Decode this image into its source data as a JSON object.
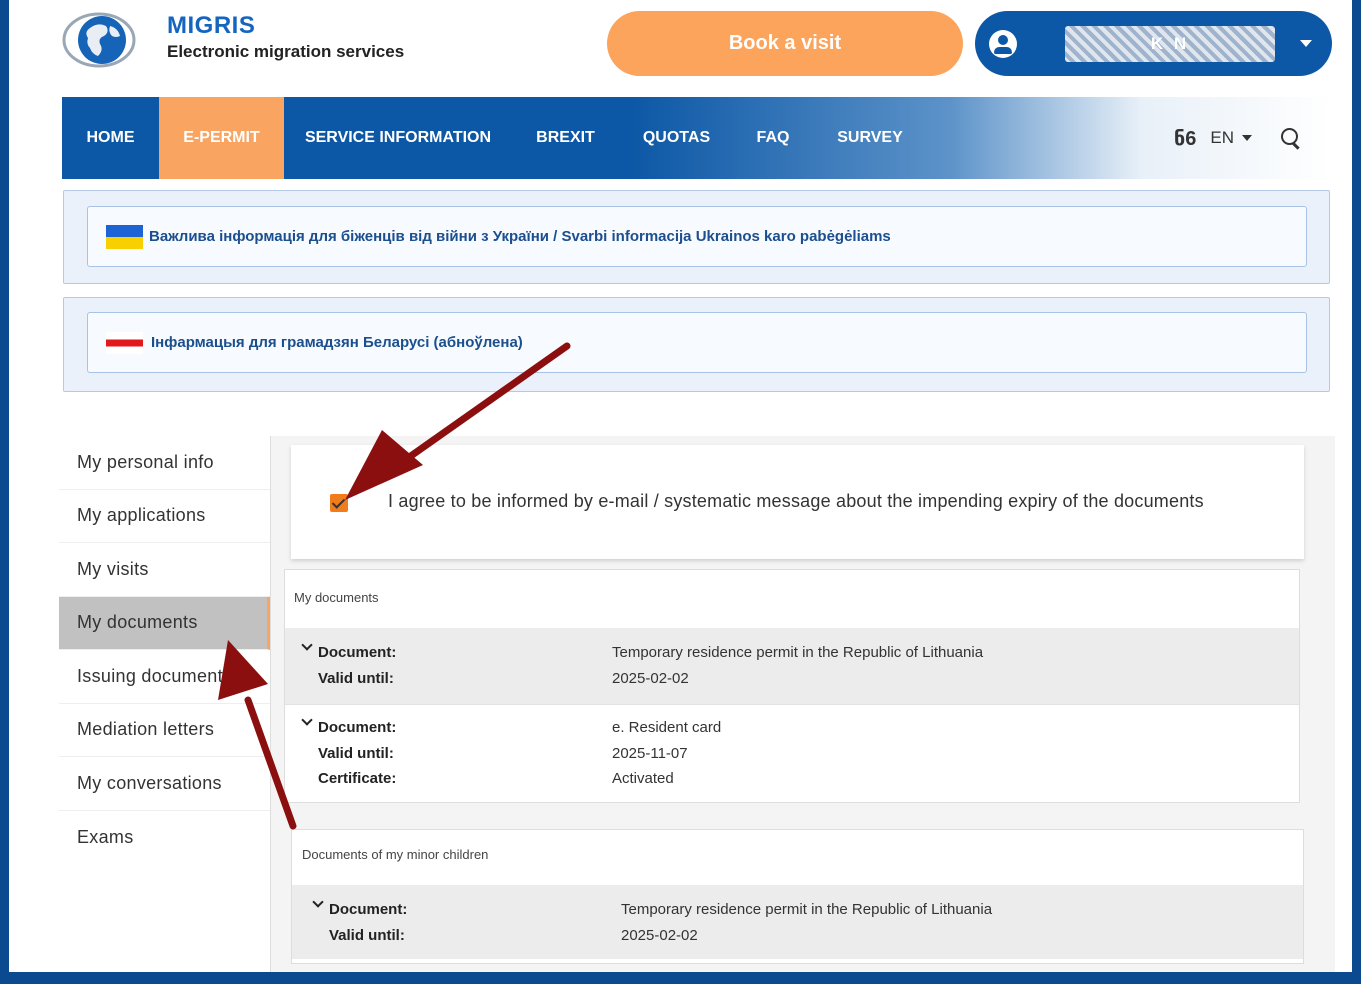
{
  "header": {
    "brand_title": "MIGRIS",
    "brand_subtitle": "Electronic migration services",
    "book_visit_label": "Book a visit",
    "user_name_masked": "K N",
    "logo_icon": "globe-logo-icon"
  },
  "nav": {
    "items": [
      {
        "label": "HOME"
      },
      {
        "label": "E-PERMIT",
        "active": true
      },
      {
        "label": "SERVICE INFORMATION"
      },
      {
        "label": "BREXIT"
      },
      {
        "label": "QUOTAS"
      },
      {
        "label": "FAQ"
      },
      {
        "label": "SURVEY"
      }
    ],
    "accessibility_icon": "ნ6",
    "language": "EN"
  },
  "notices": {
    "ukraine": "Важлива інформація для біженців від війни з України / Svarbi informacija Ukrainos karo pabėgėliams",
    "belarus": "Інфармацыя для грамадзян Беларусі (абноўлена)"
  },
  "sidebar": {
    "items": [
      {
        "label": "My personal info"
      },
      {
        "label": "My applications"
      },
      {
        "label": "My visits"
      },
      {
        "label": "My documents",
        "active": true
      },
      {
        "label": "Issuing documents"
      },
      {
        "label": "Mediation letters"
      },
      {
        "label": "My conversations"
      },
      {
        "label": "Exams"
      }
    ]
  },
  "consent": {
    "checked": true,
    "text": "I agree to be informed by e-mail / systematic message about the impending expiry of the documents"
  },
  "my_documents": {
    "title": "My documents",
    "rows": [
      {
        "document_label": "Document:",
        "document": "Temporary residence permit in the Republic of Lithuania",
        "valid_label": "Valid until:",
        "valid_until": "2025-02-02"
      },
      {
        "document_label": "Document:",
        "document": "e. Resident card",
        "valid_label": "Valid until:",
        "valid_until": "2025-11-07",
        "certificate_label": "Certificate:",
        "certificate": "Activated"
      }
    ]
  },
  "children_documents": {
    "title": "Documents of my minor children",
    "rows": [
      {
        "document_label": "Document:",
        "document": "Temporary residence permit in the Republic of Lithuania",
        "valid_label": "Valid until:",
        "valid_until": "2025-02-02"
      }
    ]
  },
  "colors": {
    "brand_blue": "#0d58a6",
    "accent_orange": "#f9a561",
    "arrow_red": "#8b0f0f"
  }
}
